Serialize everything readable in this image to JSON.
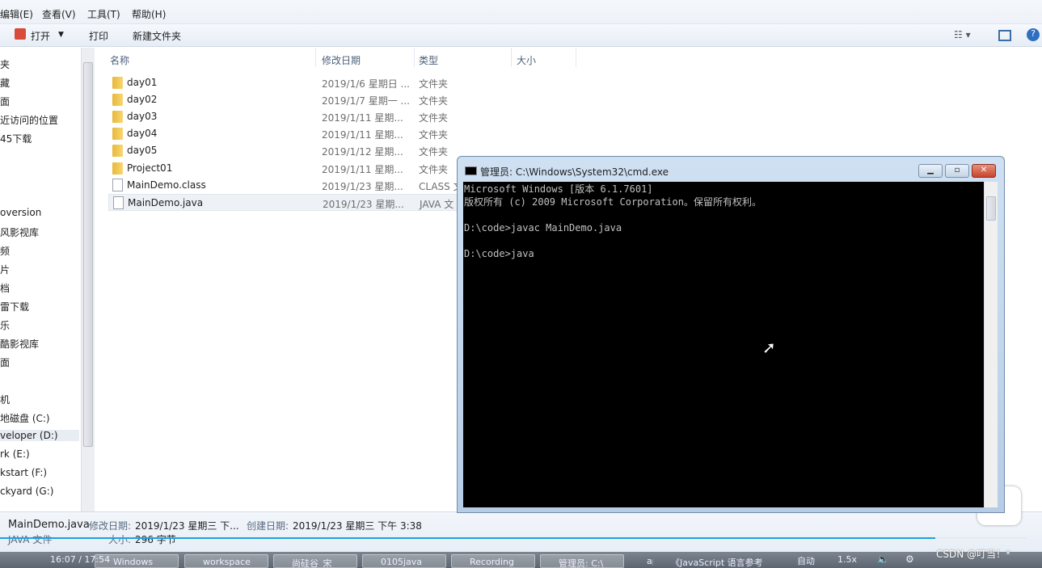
{
  "menu": [
    "编辑(E)",
    "查看(V)",
    "工具(T)",
    "帮助(H)"
  ],
  "toolbar": {
    "open": "打开",
    "print": "打印",
    "new_folder": "新建文件夹"
  },
  "nav": [
    "夹",
    "藏",
    "面",
    "近访问的位置",
    "45下载",
    "oversion",
    "风影视库",
    "频",
    "片",
    "档",
    "雷下载",
    "乐",
    "酷影视库",
    "面",
    "机",
    "地磁盘 (C:)",
    "veloper (D:)",
    "rk (E:)",
    "kstart (F:)",
    "ckyard (G:)"
  ],
  "columns": {
    "name": "名称",
    "date": "修改日期",
    "type": "类型",
    "size": "大小"
  },
  "files": [
    {
      "name": "day01",
      "date": "2019/1/6 星期日 ...",
      "type": "文件夹",
      "kind": "folder"
    },
    {
      "name": "day02",
      "date": "2019/1/7 星期一 ...",
      "type": "文件夹",
      "kind": "folder"
    },
    {
      "name": "day03",
      "date": "2019/1/11 星期...",
      "type": "文件夹",
      "kind": "folder"
    },
    {
      "name": "day04",
      "date": "2019/1/11 星期...",
      "type": "文件夹",
      "kind": "folder"
    },
    {
      "name": "day05",
      "date": "2019/1/12 星期...",
      "type": "文件夹",
      "kind": "folder"
    },
    {
      "name": "Project01",
      "date": "2019/1/11 星期...",
      "type": "文件夹",
      "kind": "folder"
    },
    {
      "name": "MainDemo.class",
      "date": "2019/1/23 星期...",
      "type": "CLASS 文",
      "kind": "file"
    },
    {
      "name": "MainDemo.java",
      "date": "2019/1/23 星期...",
      "type": "JAVA 文",
      "kind": "file"
    }
  ],
  "status": {
    "filename": "MainDemo.java",
    "modified_label": "修改日期:",
    "modified": "2019/1/23 星期三 下...",
    "created_label": "创建日期:",
    "created": "2019/1/23 星期三 下午 3:38",
    "type": "JAVA 文件",
    "size_label": "大小:",
    "size": "296 字节"
  },
  "video": {
    "time": "16:07 / 17:54",
    "auto": "自动",
    "speed": "1.5x",
    "progress": 0.9,
    "watermark": "CSDN @叮当！*"
  },
  "taskbar": [
    "Windows",
    "workspace",
    "尚硅谷_宋",
    "0105java",
    "Recording",
    "管理员: C:\\",
    "api",
    "《JavaScript 语言参考"
  ],
  "cmd": {
    "title": "管理员: C:\\Windows\\System32\\cmd.exe",
    "lines": [
      "Microsoft Windows [版本 6.1.7601]",
      "版权所有 (c) 2009 Microsoft Corporation。保留所有权利。",
      "",
      "D:\\code>javac MainDemo.java",
      "",
      "D:\\code>java"
    ]
  }
}
